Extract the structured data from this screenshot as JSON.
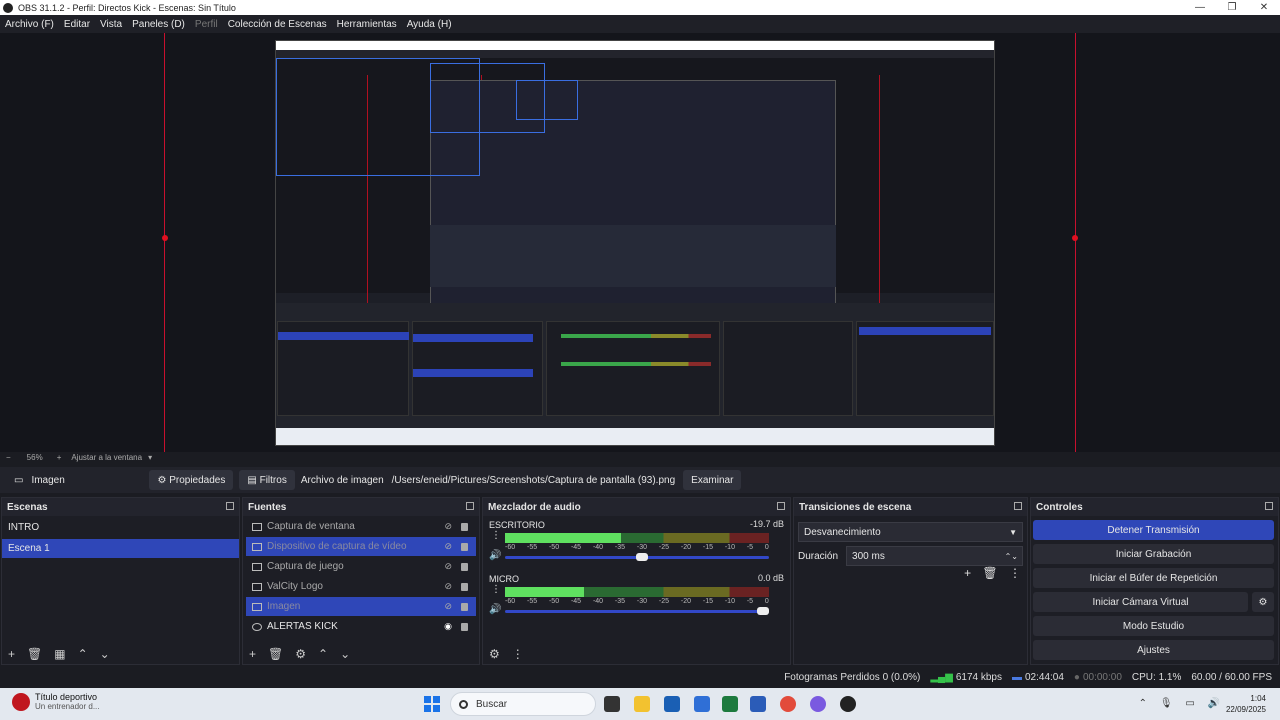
{
  "titlebar": {
    "title": "OBS 31.1.2 - Perfil: Directos Kick - Escenas: Sin Título",
    "minimize": "—",
    "maximize": "❐",
    "close": "✕"
  },
  "menu": {
    "archivo": "Archivo (F)",
    "editar": "Editar",
    "vista": "Vista",
    "paneles": "Paneles (D)",
    "perfil": "Perfil",
    "coleccion": "Colección de Escenas",
    "herramientas": "Herramientas",
    "ayuda": "Ayuda (H)"
  },
  "zoom": {
    "minus": "−",
    "level": "56%",
    "plus": "+",
    "fit": "Ajustar a la ventana",
    "caret": "▾"
  },
  "source_toolbar": {
    "source_name": "Imagen",
    "properties": "Propiedades",
    "filters": "Filtros",
    "file_label": "Archivo de imagen",
    "file_path": "/Users/eneid/Pictures/Screenshots/Captura de pantalla (93).png",
    "browse": "Examinar"
  },
  "scenes": {
    "title": "Escenas",
    "items": [
      {
        "label": "INTRO"
      },
      {
        "label": "Escena 1"
      }
    ]
  },
  "sources": {
    "title": "Fuentes",
    "items": [
      {
        "label": "Captura de ventana"
      },
      {
        "label": "Dispositivo de captura de vídeo"
      },
      {
        "label": "Captura de juego"
      },
      {
        "label": "ValCity Logo"
      },
      {
        "label": "Imagen"
      },
      {
        "label": "ALERTAS KICK"
      }
    ]
  },
  "mixer": {
    "title": "Mezclador de audio",
    "channels": [
      {
        "name": "ESCRITORIO",
        "db": "-19.7 dB",
        "level": 0.44,
        "volume": 0.52
      },
      {
        "name": "MICRO",
        "db": "0.0 dB",
        "level": 0.3,
        "volume": 1.0
      }
    ],
    "scale": [
      "-60",
      "-55",
      "-50",
      "-45",
      "-40",
      "-35",
      "-30",
      "-25",
      "-20",
      "-15",
      "-10",
      "-5",
      "0"
    ]
  },
  "transitions": {
    "title": "Transiciones de escena",
    "selected": "Desvanecimiento",
    "duration_label": "Duración",
    "duration_value": "300 ms"
  },
  "controls": {
    "title": "Controles",
    "stop_stream": "Detener Transmisión",
    "start_recording": "Iniciar Grabación",
    "replay_buffer": "Iniciar el Búfer de Repetición",
    "virtual_cam": "Iniciar Cámara Virtual",
    "studio_mode": "Modo Estudio",
    "settings": "Ajustes"
  },
  "status": {
    "dropped_frames": "Fotogramas Perdidos 0 (0.0%)",
    "bitrate": "6174 kbps",
    "stream_time": "02:44:04",
    "rec_time": "00:00:00",
    "cpu": "CPU: 1.1%",
    "fps": "60.00 / 60.00 FPS"
  },
  "taskbar": {
    "news_title": "Título deportivo",
    "news_sub": "Un entrenador d...",
    "search": "Buscar",
    "time": "1:04",
    "date": "22/09/2025"
  },
  "colors": {
    "accent": "#2f47b8",
    "background": "#1b1c22",
    "meter_green": "#5fe060",
    "canvas_border": "#c8102e"
  }
}
